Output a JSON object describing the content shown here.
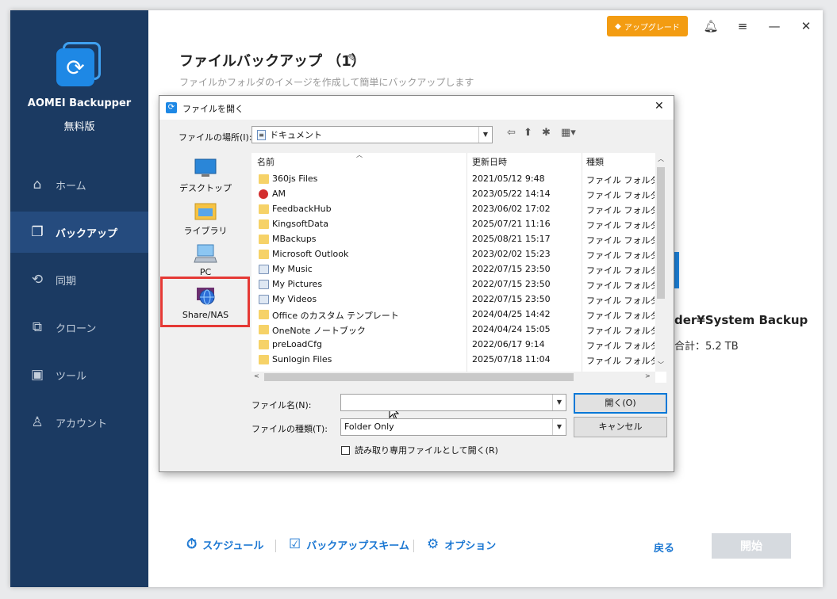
{
  "app": {
    "name": "AOMEI Backupper",
    "edition": "無料版",
    "upgrade_label": "アップグレード"
  },
  "nav": [
    {
      "label": "ホーム",
      "icon": "home-icon",
      "active": false
    },
    {
      "label": "バックアップ",
      "icon": "backup-icon",
      "active": true
    },
    {
      "label": "同期",
      "icon": "sync-icon",
      "active": false
    },
    {
      "label": "クローン",
      "icon": "clone-icon",
      "active": false
    },
    {
      "label": "ツール",
      "icon": "tools-icon",
      "active": false
    },
    {
      "label": "アカウント",
      "icon": "account-icon",
      "active": false
    }
  ],
  "main": {
    "title": "ファイルバックアップ （1）",
    "subtitle": "ファイルかフォルダのイメージを作成して簡単にバックアップします",
    "dest_partial": "der¥System Backup",
    "total_partial": "合計：5.2 TB"
  },
  "bottom": {
    "schedule": "スケジュール",
    "scheme": "バックアップスキーム",
    "options": "オプション",
    "back": "戻る",
    "start": "開始"
  },
  "dialog": {
    "title": "ファイルを開く",
    "location_label": "ファイルの場所(I):",
    "location_value": "ドキュメント",
    "places": [
      {
        "label": "デスクトップ",
        "icon": "desktop-icon"
      },
      {
        "label": "ライブラリ",
        "icon": "library-icon"
      },
      {
        "label": "PC",
        "icon": "pc-icon"
      },
      {
        "label": "Share/NAS",
        "icon": "network-globe-icon"
      }
    ],
    "columns": {
      "name": "名前",
      "date": "更新日時",
      "type": "種類"
    },
    "rows": [
      {
        "name": "360js Files",
        "date": "2021/05/12 9:48",
        "type": "ファイル フォルダー",
        "icon": "folder"
      },
      {
        "name": "AM",
        "date": "2023/05/22 14:14",
        "type": "ファイル フォルダー",
        "icon": "am"
      },
      {
        "name": "FeedbackHub",
        "date": "2023/06/02 17:02",
        "type": "ファイル フォルダー",
        "icon": "folder"
      },
      {
        "name": "KingsoftData",
        "date": "2025/07/21 11:16",
        "type": "ファイル フォルダー",
        "icon": "folder"
      },
      {
        "name": "MBackups",
        "date": "2025/08/21 15:17",
        "type": "ファイル フォルダー",
        "icon": "folder"
      },
      {
        "name": "Microsoft Outlook",
        "date": "2023/02/02 15:23",
        "type": "ファイル フォルダー",
        "icon": "folder"
      },
      {
        "name": "My Music",
        "date": "2022/07/15 23:50",
        "type": "ファイル フォルダー",
        "icon": "special"
      },
      {
        "name": "My Pictures",
        "date": "2022/07/15 23:50",
        "type": "ファイル フォルダー",
        "icon": "special"
      },
      {
        "name": "My Videos",
        "date": "2022/07/15 23:50",
        "type": "ファイル フォルダー",
        "icon": "special"
      },
      {
        "name": "Office のカスタム テンプレート",
        "date": "2024/04/25 14:42",
        "type": "ファイル フォルダー",
        "icon": "folder"
      },
      {
        "name": "OneNote ノートブック",
        "date": "2024/04/24 15:05",
        "type": "ファイル フォルダー",
        "icon": "folder"
      },
      {
        "name": "preLoadCfg",
        "date": "2022/06/17 9:14",
        "type": "ファイル フォルダー",
        "icon": "folder"
      },
      {
        "name": "Sunlogin Files",
        "date": "2025/07/18 11:04",
        "type": "ファイル フォルダー",
        "icon": "folder"
      }
    ],
    "filename_label": "ファイル名(N):",
    "filename_value": "",
    "filetype_label": "ファイルの種類(T):",
    "filetype_value": "Folder Only",
    "open_button": "開く(O)",
    "cancel_button": "キャンセル",
    "readonly_label": "読み取り専用ファイルとして開く(R)"
  },
  "colors": {
    "sidebar": "#1b3a62",
    "sidebar_active": "#254b7e",
    "accent": "#1976d2",
    "upgrade": "#f39c12",
    "highlight": "#e53935"
  }
}
